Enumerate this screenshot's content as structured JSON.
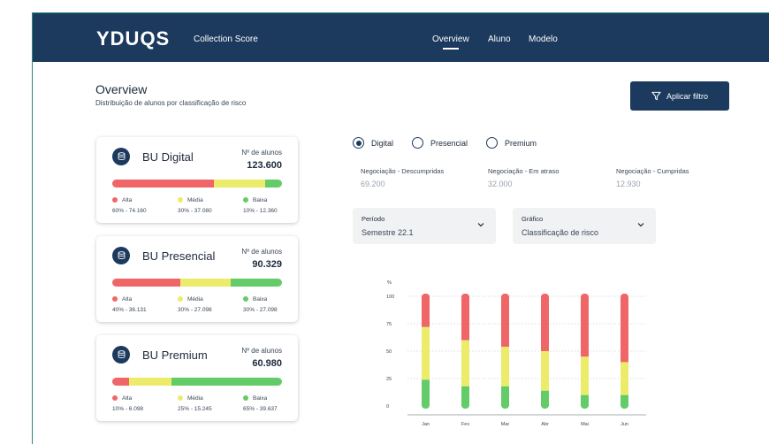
{
  "header": {
    "logo": "YDUQS",
    "app_name": "Collection Score",
    "nav": [
      "Overview",
      "Aluno",
      "Modelo"
    ],
    "active_nav": "Overview"
  },
  "page": {
    "title": "Overview",
    "subtitle": "Distribuição de alunos por classificação de risco",
    "filter_button": "Aplicar filtro"
  },
  "cards": [
    {
      "name": "BU Digital",
      "count_label": "Nº de alunos",
      "count": "123.600",
      "shares": [
        0.6,
        0.3,
        0.1
      ],
      "legend": [
        {
          "label": "Alta",
          "value": "60% - 74.160"
        },
        {
          "label": "Média",
          "value": "30% - 37.080"
        },
        {
          "label": "Baixa",
          "value": "10% - 12.360"
        }
      ]
    },
    {
      "name": "BU Presencial",
      "count_label": "Nº de alunos",
      "count": "90.329",
      "shares": [
        0.4,
        0.3,
        0.3
      ],
      "legend": [
        {
          "label": "Alta",
          "value": "40% - 36.131"
        },
        {
          "label": "Média",
          "value": "30% - 27.098"
        },
        {
          "label": "Baixa",
          "value": "30% - 27.098"
        }
      ]
    },
    {
      "name": "BU Premium",
      "count_label": "Nº de alunos",
      "count": "60.980",
      "shares": [
        0.1,
        0.25,
        0.65
      ],
      "legend": [
        {
          "label": "Alta",
          "value": "10% - 6.098"
        },
        {
          "label": "Média",
          "value": "25% - 15.245"
        },
        {
          "label": "Baixa",
          "value": "65% - 39.637"
        }
      ]
    }
  ],
  "radios": [
    {
      "label": "Digital",
      "selected": true
    },
    {
      "label": "Presencial",
      "selected": false
    },
    {
      "label": "Premium",
      "selected": false
    }
  ],
  "stats": [
    {
      "label": "Negociação - Descumpridas",
      "value": "69.200"
    },
    {
      "label": "Negociação - Em atraso",
      "value": "32.000"
    },
    {
      "label": "Negociação - Cumpridas",
      "value": "12.930"
    }
  ],
  "selects": [
    {
      "label": "Período",
      "value": "Semestre 22.1"
    },
    {
      "label": "Gráfico",
      "value": "Classificação de risco"
    }
  ],
  "colors": {
    "navy": "#1c3a5e",
    "alta": "#f06668",
    "media": "#ecec6a",
    "baixa": "#63cc68"
  },
  "chart_data": {
    "type": "bar",
    "stacked": true,
    "ylabel": "%",
    "yticks": [
      0,
      25,
      50,
      75,
      100
    ],
    "ylim": [
      0,
      100
    ],
    "categories": [
      "Jan",
      "Fev",
      "Mar",
      "Abr",
      "Mai",
      "Jun"
    ],
    "series": [
      {
        "key": "baixa",
        "values": [
          24,
          18,
          18,
          14,
          10,
          10
        ]
      },
      {
        "key": "media",
        "values": [
          48,
          42,
          36,
          36,
          35,
          30
        ]
      },
      {
        "key": "alta",
        "values": [
          28,
          40,
          46,
          50,
          55,
          60
        ]
      }
    ],
    "grid": true
  }
}
